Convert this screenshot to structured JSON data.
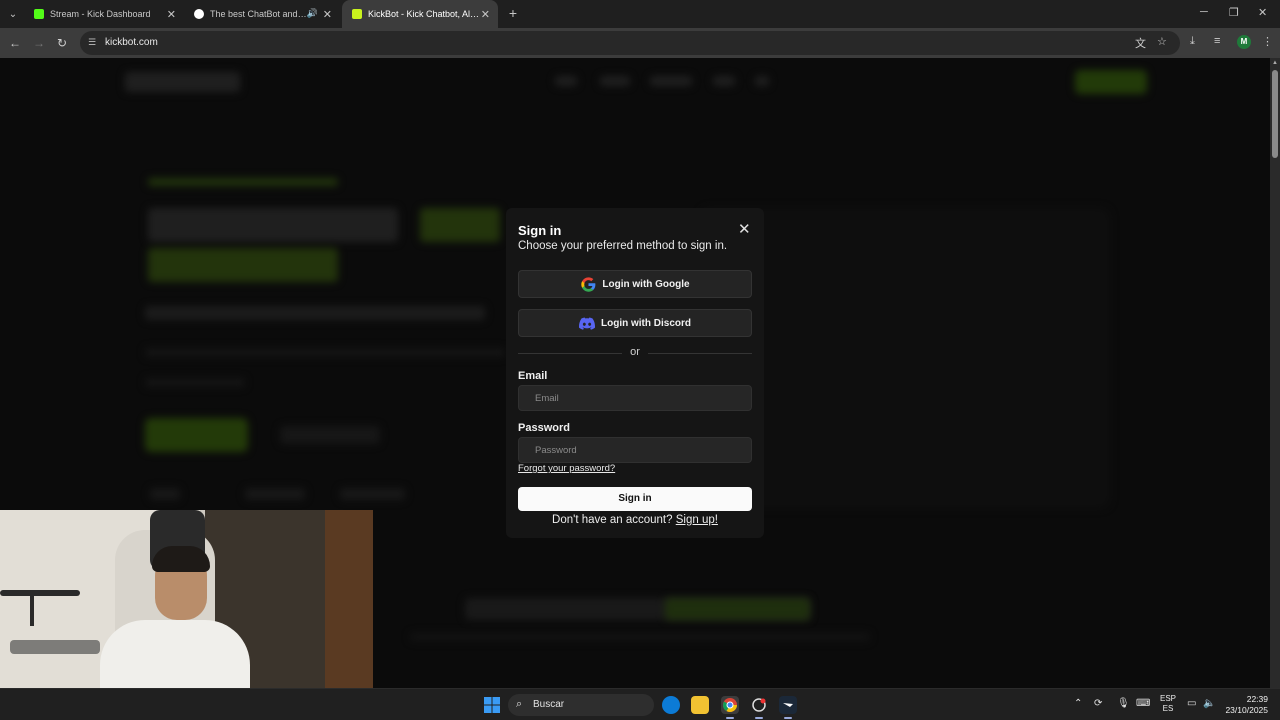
{
  "browser": {
    "tabs": [
      {
        "title": "Stream - Kick Dashboard",
        "favicon_color": "#53fc18"
      },
      {
        "title": "The best ChatBot and Widg",
        "favicon_color": "#ffffff"
      },
      {
        "title": "KickBot - Kick Chatbot, Alerts, T",
        "favicon_color": "#c9f31d"
      }
    ],
    "url": "kickbot.com",
    "profile_initial": "M"
  },
  "modal": {
    "title": "Sign in",
    "subtitle": "Choose your preferred method to sign in.",
    "google_label": "Login with Google",
    "discord_label": "Login with Discord",
    "divider_label": "or",
    "email_label": "Email",
    "email_placeholder": "Email",
    "password_label": "Password",
    "password_placeholder": "Password",
    "forgot_label": "Forgot your password?",
    "signin_label": "Sign in",
    "signup_prompt": "Don't have an account?",
    "signup_link": "Sign up!"
  },
  "taskbar": {
    "search_label": "Buscar",
    "lang_top": "ESP",
    "lang_bottom": "ES",
    "time": "22:39",
    "date": "23/10/2025"
  },
  "colors": {
    "accent_green": "#53fc18",
    "discord": "#5865f2"
  }
}
